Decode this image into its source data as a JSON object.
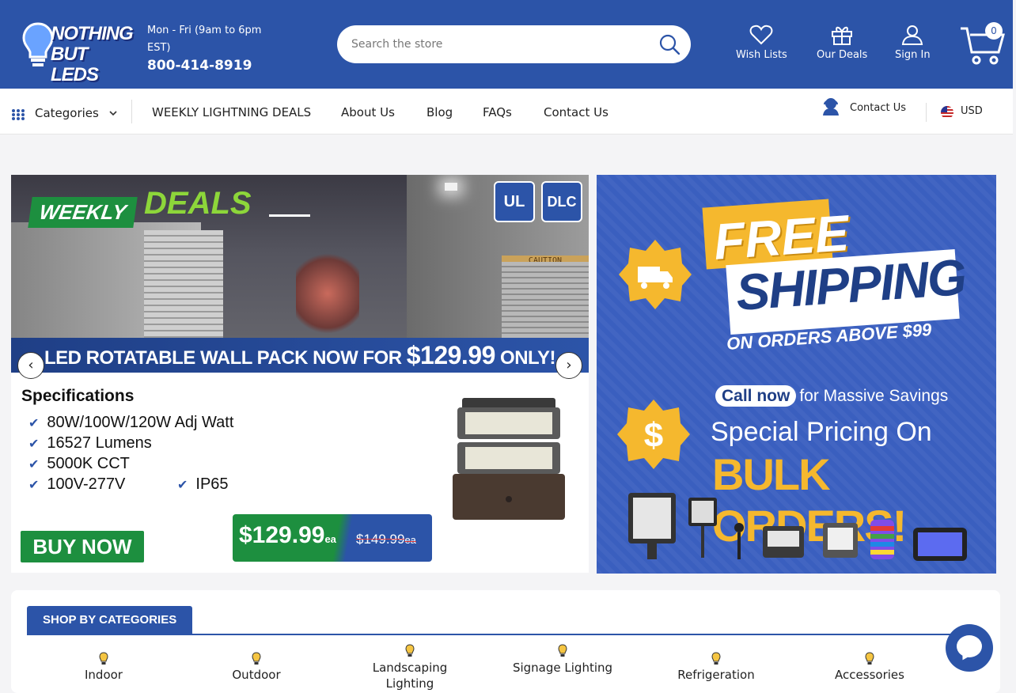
{
  "header": {
    "logo_line1": "NOTHING",
    "logo_line2": "BUT LEDS",
    "hours": "Mon - Fri (9am to 6pm EST)",
    "phone": "800-414-8919",
    "search_placeholder": "Search the store",
    "wish_lists": "Wish Lists",
    "our_deals": "Our Deals",
    "sign_in": "Sign In",
    "cart_count": "0"
  },
  "nav": {
    "categories": "Categories",
    "links": [
      "WEEKLY LIGHTNING DEALS",
      "About Us",
      "Blog",
      "FAQs",
      "Contact Us"
    ],
    "contact_label": "Contact Us",
    "currency": "USD"
  },
  "banner_left": {
    "weekly": "WEEKLY",
    "deals": "DEALS",
    "cert1": "UL",
    "cert2": "DLC",
    "caution": "CAUTION",
    "promo_prefix": "LED ROTATABLE WALL PACK NOW FOR ",
    "promo_price": "$129.99",
    "promo_suffix": " ONLY!",
    "spec_title": "Specifications",
    "specs": [
      "80W/100W/120W Adj Watt",
      "16527 Lumens",
      "5000K CCT",
      "100V-277V",
      "IP65"
    ],
    "buy_now": "BUY NOW",
    "price_new": "$129.99",
    "price_old": "$149.99",
    "price_unit": "ea"
  },
  "banner_right": {
    "free": "FREE",
    "shipping": "SHIPPING",
    "on_orders": "ON ORDERS ABOVE $99",
    "call_now": "Call now",
    "call_suffix": "for Massive Savings",
    "special": "Special Pricing On",
    "bulk": "BULK ORDERS!"
  },
  "categories_section": {
    "title": "SHOP BY CATEGORIES",
    "items": [
      "Indoor",
      "Outdoor",
      "Landscaping Lighting",
      "Signage Lighting",
      "Refrigeration",
      "Accessories"
    ]
  },
  "colors": {
    "brand_blue": "#2c54a8",
    "deal_green": "#1d8f3f",
    "accent_yellow": "#f5b82e"
  }
}
